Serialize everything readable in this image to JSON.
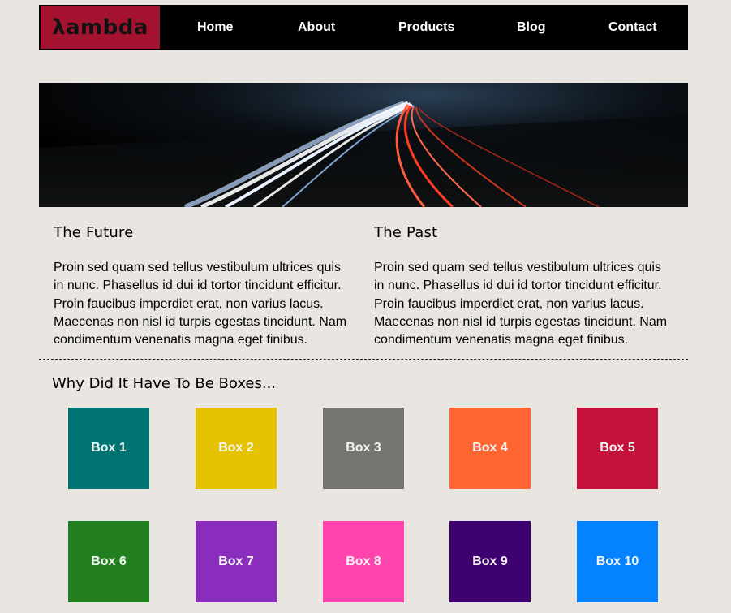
{
  "header": {
    "logo_text": "λambda",
    "nav": [
      {
        "label": "Home"
      },
      {
        "label": "About"
      },
      {
        "label": "Products"
      },
      {
        "label": "Blog"
      },
      {
        "label": "Contact"
      }
    ]
  },
  "colors": {
    "background": "#e9e6e1",
    "logo_bg": "#a3122f",
    "nav_bg": "#000000"
  },
  "hero": {
    "image": "night-highway-light-trails"
  },
  "sections": [
    {
      "title": "The Future",
      "body": "Proin sed quam sed tellus vestibulum ultrices quis in nunc. Phasellus id dui id tortor tincidunt efficitur. Proin faucibus imperdiet erat, non varius lacus. Maecenas non nisl id turpis egestas tincidunt. Nam condimentum venenatis magna eget finibus."
    },
    {
      "title": "The Past",
      "body": "Proin sed quam sed tellus vestibulum ultrices quis in nunc. Phasellus id dui id tortor tincidunt efficitur. Proin faucibus imperdiet erat, non varius lacus. Maecenas non nisl id turpis egestas tincidunt. Nam condimentum venenatis magna eget finibus."
    }
  ],
  "boxes_section": {
    "title": "Why Did It Have To Be Boxes...",
    "boxes": [
      {
        "label": "Box 1",
        "color": "#007373"
      },
      {
        "label": "Box 2",
        "color": "#e6c300"
      },
      {
        "label": "Box 3",
        "color": "#76746f"
      },
      {
        "label": "Box 4",
        "color": "#ff6530"
      },
      {
        "label": "Box 5",
        "color": "#c4123a"
      },
      {
        "label": "Box 6",
        "color": "#217f1f"
      },
      {
        "label": "Box 7",
        "color": "#8a2dbd"
      },
      {
        "label": "Box 8",
        "color": "#ff44ad"
      },
      {
        "label": "Box 9",
        "color": "#3f0071"
      },
      {
        "label": "Box 10",
        "color": "#0582ff"
      }
    ]
  }
}
